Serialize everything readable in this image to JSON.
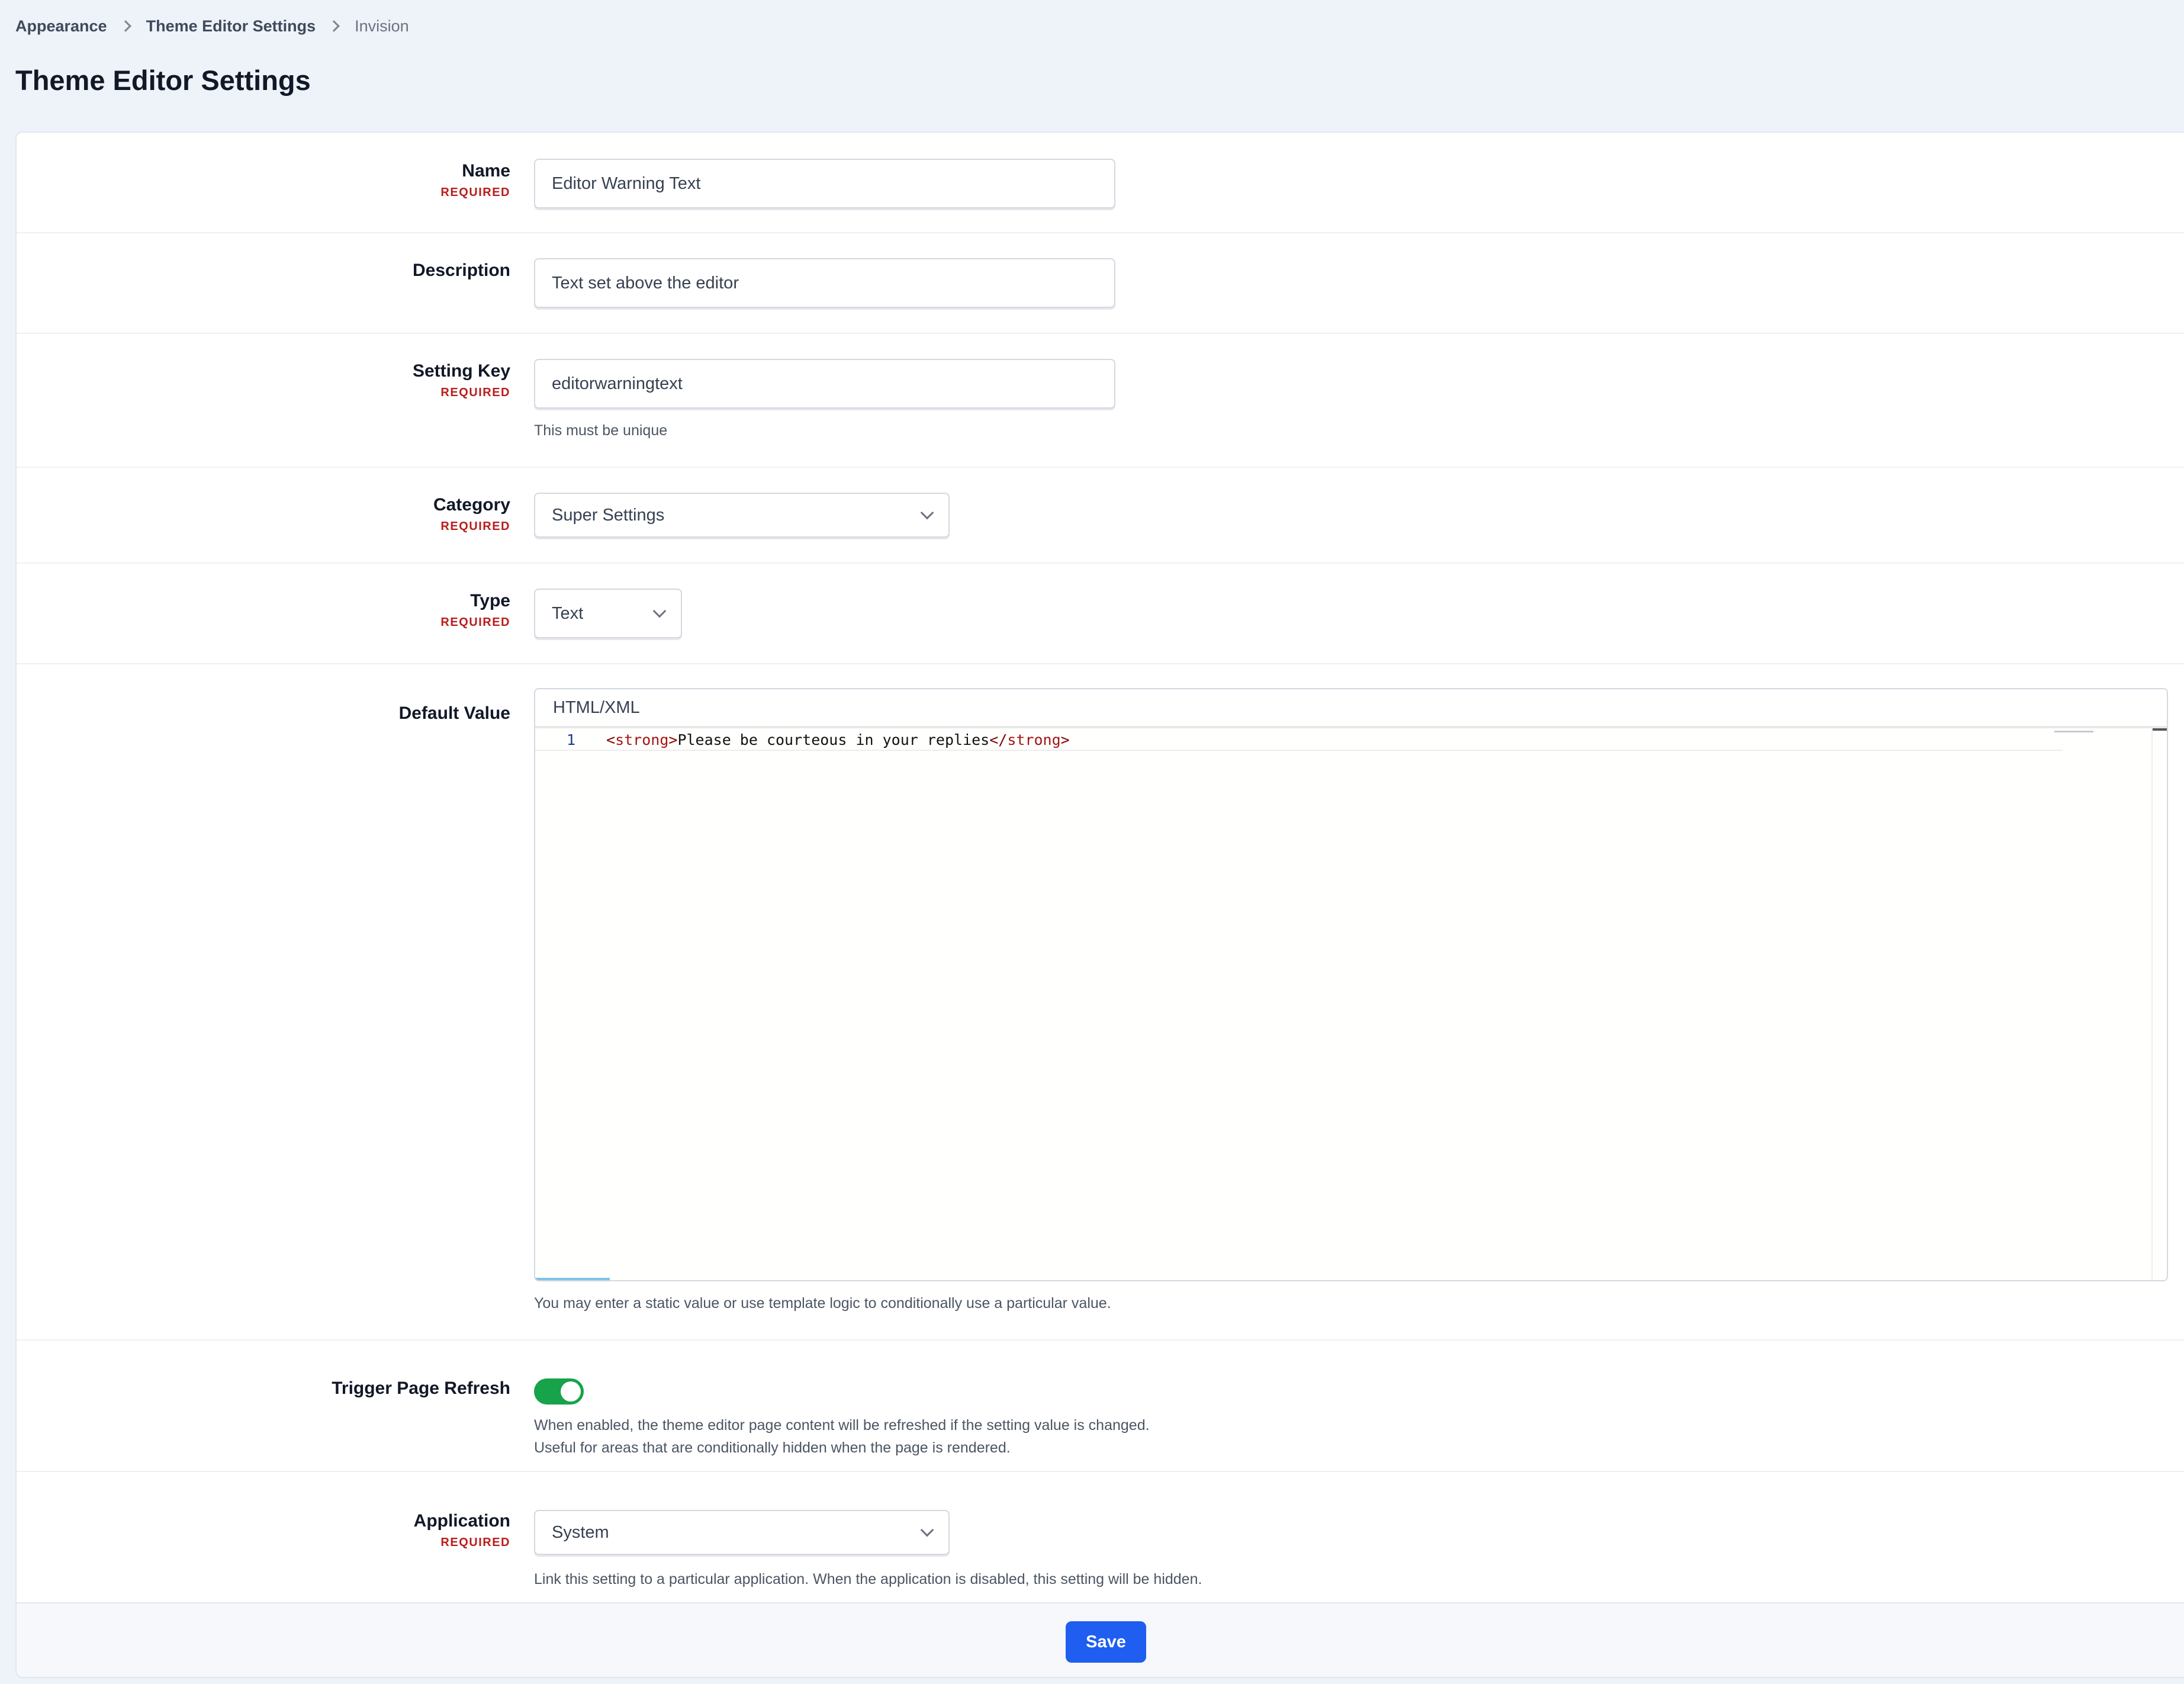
{
  "breadcrumb": {
    "items": [
      "Appearance",
      "Theme Editor Settings"
    ],
    "current": "Invision"
  },
  "page_title": "Theme Editor Settings",
  "required_label": "REQUIRED",
  "form": {
    "name": {
      "label": "Name",
      "value": "Editor Warning Text"
    },
    "description": {
      "label": "Description",
      "value": "Text set above the editor"
    },
    "setting_key": {
      "label": "Setting Key",
      "value": "editorwarningtext",
      "help": "This must be unique"
    },
    "category": {
      "label": "Category",
      "value": "Super Settings"
    },
    "type": {
      "label": "Type",
      "value": "Text"
    },
    "default_value": {
      "label": "Default Value",
      "editor_mode": "HTML/XML",
      "line_number": "1",
      "code": {
        "open_lt": "<",
        "open_tag": "strong",
        "open_gt": ">",
        "text": "Please be courteous in your replies",
        "close_lt": "</",
        "close_tag": "strong",
        "close_gt": ">"
      },
      "help": "You may enter a static value or use template logic to conditionally use a particular value."
    },
    "trigger_refresh": {
      "label": "Trigger Page Refresh",
      "enabled": true,
      "help_line1": "When enabled, the theme editor page content will be refreshed if the setting value is changed.",
      "help_line2": "Useful for areas that are conditionally hidden when the page is rendered."
    },
    "application": {
      "label": "Application",
      "value": "System",
      "help": "Link this setting to a particular application. When the application is disabled, this setting will be hidden."
    }
  },
  "save_label": "Save",
  "colors": {
    "accent": "#1f5ef0",
    "required": "#b91c1c",
    "toggle_on": "#16a34a",
    "background": "#eef2f9"
  }
}
